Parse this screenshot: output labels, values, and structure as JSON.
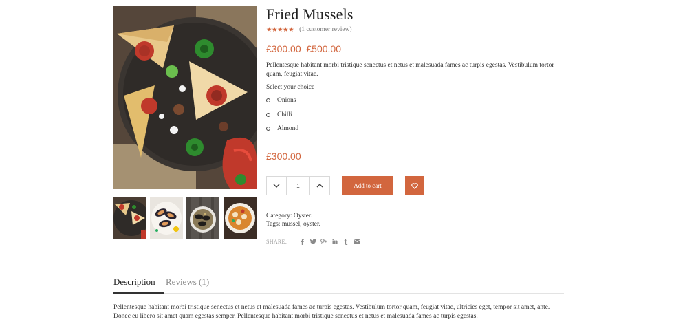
{
  "product": {
    "title": "Fried Mussels",
    "stars": "★★★★★",
    "rating_value": 5,
    "review_link": "(1 customer review)",
    "price_range": "£300.00–£500.00",
    "short_description": "Pellentesque habitant morbi tristique senectus et netus et malesuada fames ac turpis egestas. Vestibulum tortor quam, feugiat vitae.",
    "choice_label": "Select your choice",
    "choices": [
      "Onions",
      "Chilli",
      "Almond"
    ],
    "selected_price": "£300.00",
    "quantity": "1",
    "add_to_cart_label": "Add to cart",
    "category_label": "Category:",
    "category_value": "Oyster.",
    "tags_label": "Tags:",
    "tags_value": "mussel, oyster.",
    "share_label": "SHARE:",
    "share_icons": [
      "facebook-icon",
      "twitter-icon",
      "google-plus-icon",
      "linkedin-icon",
      "tumblr-icon",
      "email-icon"
    ]
  },
  "tabs": {
    "description_label": "Description",
    "reviews_label": "Reviews (1)",
    "description_text": "Pellentesque habitant morbi tristique senectus et netus et malesuada fames ac turpis egestas. Vestibulum tortor quam, feugiat vitae, ultricies eget, tempor sit amet, ante. Donec eu libero sit amet quam egestas semper. Pellentesque habitant morbi tristique senectus et netus et malesuada fames ac turpis egestas."
  },
  "colors": {
    "accent": "#d2663e",
    "text": "#333333",
    "muted": "#888888"
  }
}
